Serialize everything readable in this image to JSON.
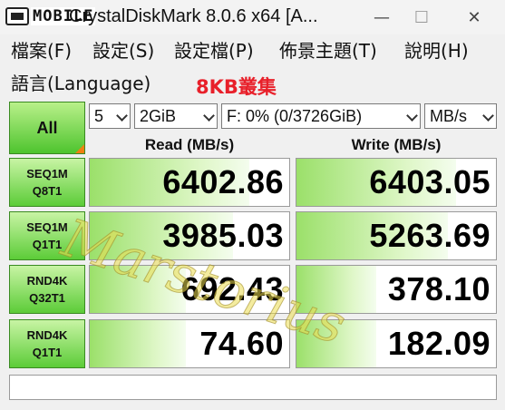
{
  "titlebar": {
    "logo_text": "MOBILE",
    "title": "CrystalDiskMark 8.0.6 x64 [A...",
    "min_glyph": "—",
    "max_glyph": "☐",
    "close_glyph": "✕"
  },
  "menu": {
    "file": "檔案(F)",
    "settings": "設定(S)",
    "profile": "設定檔(P)",
    "theme": "佈景主題(T)",
    "help": "說明(H)",
    "language": "語言(Language)"
  },
  "annotation_label": "8KB叢集",
  "controls": {
    "all_label": "All",
    "count": "5",
    "size": "2GiB",
    "drive": "F: 0% (0/3726GiB)",
    "unit": "MB/s"
  },
  "headers": {
    "read": "Read (MB/s)",
    "write": "Write (MB/s)"
  },
  "rows": [
    {
      "line1": "SEQ1M",
      "line2": "Q8T1",
      "read": "6402.86",
      "write": "6403.05",
      "read_fill": 0.8,
      "write_fill": 0.8
    },
    {
      "line1": "SEQ1M",
      "line2": "Q1T1",
      "read": "3985.03",
      "write": "5263.69",
      "read_fill": 0.72,
      "write_fill": 0.76
    },
    {
      "line1": "RND4K",
      "line2": "Q32T1",
      "read": "692.43",
      "write": "378.10",
      "read_fill": 0.48,
      "write_fill": 0.4
    },
    {
      "line1": "RND4K",
      "line2": "Q1T1",
      "read": "74.60",
      "write": "182.09",
      "read_fill": 0.48,
      "write_fill": 0.4
    }
  ],
  "watermark": "Marstorius",
  "colors": {
    "accent_green": "#4ec42e",
    "annotation_red": "#e8202a",
    "corner_orange": "#f08010"
  }
}
